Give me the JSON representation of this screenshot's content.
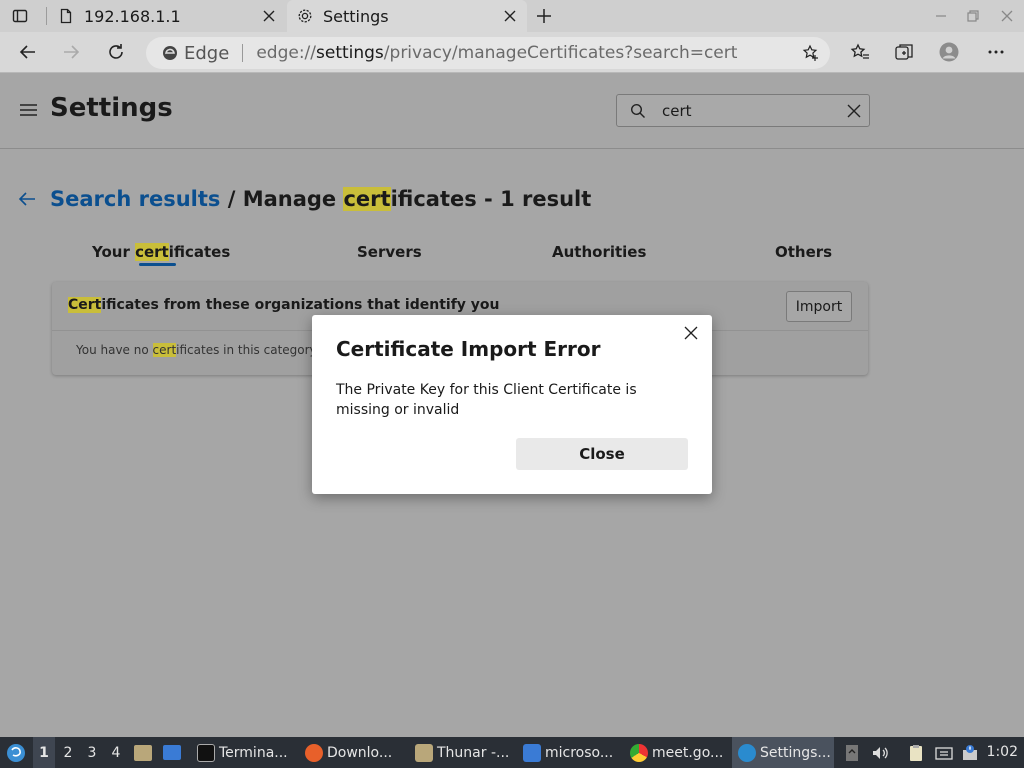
{
  "browser": {
    "tabs": [
      {
        "title": "192.168.1.1"
      },
      {
        "title": "Settings"
      }
    ],
    "address": {
      "brand": "Edge",
      "url_scheme": "edge://",
      "url_host": "settings",
      "url_path": "/privacy/manageCertificates?search=cert"
    }
  },
  "settings": {
    "title": "Settings",
    "search_value": "cert",
    "breadcrumb": {
      "link": "Search results",
      "separator": " / ",
      "page_prefix": "Manage ",
      "page_hl": "cert",
      "page_suffix": "ificates - 1 result"
    },
    "cert_tabs": {
      "your_prefix": "Your ",
      "your_hl": "cert",
      "your_suffix": "ificates",
      "servers": "Servers",
      "authorities": "Authorities",
      "others": "Others"
    },
    "card": {
      "heading_hl": "Cert",
      "heading_rest": "ificates from these organizations that identify you",
      "import_label": "Import",
      "empty_prefix": "You have no ",
      "empty_hl": "cert",
      "empty_suffix": "ificates in this category"
    }
  },
  "dialog": {
    "title": "Certificate Import Error",
    "message": "The Private Key for this Client Certificate is missing or invalid",
    "close_label": "Close"
  },
  "taskbar": {
    "workspaces": [
      "1",
      "2",
      "3",
      "4"
    ],
    "tasks": [
      {
        "label": "Termina..."
      },
      {
        "label": "Downlo..."
      },
      {
        "label": "Thunar -..."
      },
      {
        "label": "microso..."
      },
      {
        "label": "meet.go..."
      },
      {
        "label": "Settings..."
      }
    ],
    "clock": "1:02"
  },
  "colors": {
    "highlight": "#c9be3a",
    "link": "#0b4f8f",
    "taskbar": "#2a2f36"
  }
}
